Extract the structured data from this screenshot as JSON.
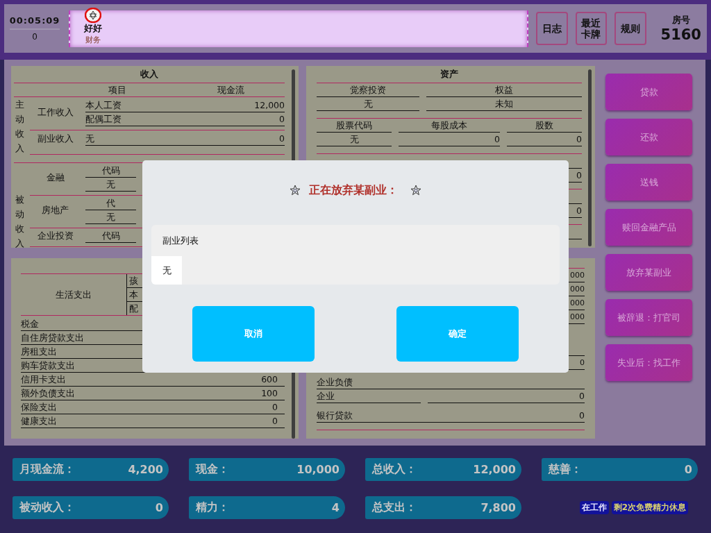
{
  "timer": {
    "time": "00:05:09",
    "count": "0"
  },
  "players": [
    {
      "name": "好好",
      "role": "财务"
    }
  ],
  "top_buttons": [
    "日志",
    "最近卡牌",
    "规则"
  ],
  "room": {
    "label": "房号",
    "number": "5160"
  },
  "income": {
    "title": "收入",
    "headers": [
      "项目",
      "现金流"
    ],
    "active": {
      "label": "主动收入",
      "groups": [
        {
          "name": "工作收入",
          "rows": [
            {
              "item": "本人工资",
              "value": "12,000"
            },
            {
              "item": "配偶工资",
              "value": "0"
            }
          ]
        },
        {
          "name": "副业收入",
          "rows": [
            {
              "item": "无",
              "value": "0"
            }
          ]
        }
      ]
    },
    "passive": {
      "label": "被动收入",
      "groups": [
        {
          "name": "金融",
          "cells": [
            "代码",
            "无"
          ]
        },
        {
          "name": "房地产",
          "cells": [
            "代",
            "无"
          ]
        },
        {
          "name": "企业投资",
          "cells": [
            "代码"
          ]
        }
      ]
    }
  },
  "assets": {
    "title": "资产",
    "insight": {
      "headers": [
        "觉察投资",
        "权益"
      ],
      "values": [
        "无",
        "未知"
      ]
    },
    "stocks": {
      "headers": [
        "股票代码",
        "每股成本",
        "股数"
      ],
      "values": [
        "无",
        "0",
        "0"
      ]
    },
    "value_rows": [
      "0",
      "0"
    ]
  },
  "expenses": {
    "living": {
      "label": "生活支出",
      "items": [
        "孩",
        "本",
        "配"
      ]
    },
    "rows": [
      {
        "item": "税金"
      },
      {
        "item": "自住房贷款支出"
      },
      {
        "item": "房租支出"
      },
      {
        "item": "购车贷款支出"
      },
      {
        "item": "信用卡支出",
        "value": "600"
      },
      {
        "item": "额外负债支出",
        "value": "100"
      },
      {
        "item": "保险支出",
        "value": "0"
      },
      {
        "item": "健康支出",
        "value": "0"
      }
    ]
  },
  "liabilities": {
    "value_rows": [
      "000",
      "000",
      "000",
      "000"
    ],
    "row_value": "0",
    "business": {
      "title": "企业负债",
      "rows": [
        {
          "item": "企业",
          "value": "0"
        }
      ]
    },
    "bank_loan": {
      "item": "银行贷款",
      "value": "0"
    }
  },
  "actions": [
    "贷款",
    "还款",
    "送钱",
    "赎回金融产品",
    "放弃某副业",
    "被辞退：打官司",
    "失业后：找工作"
  ],
  "stats": [
    {
      "label": "月现金流：",
      "value": "4,200"
    },
    {
      "label": "现金：",
      "value": "10,000"
    },
    {
      "label": "总收入：",
      "value": "12,000"
    },
    {
      "label": "慈善：",
      "value": "0"
    },
    {
      "label": "被动收入：",
      "value": "0"
    },
    {
      "label": "精力：",
      "value": "4"
    },
    {
      "label": "总支出：",
      "value": "7,800"
    }
  ],
  "tags": [
    {
      "text": "在工作",
      "kind": "status"
    },
    {
      "text": "剩2次免费精力休息",
      "kind": "note"
    }
  ],
  "modal": {
    "title": "正在放弃某副业：",
    "list": {
      "heading": "副业列表",
      "items": [
        "无"
      ]
    },
    "buttons": [
      "取消",
      "确定"
    ]
  }
}
